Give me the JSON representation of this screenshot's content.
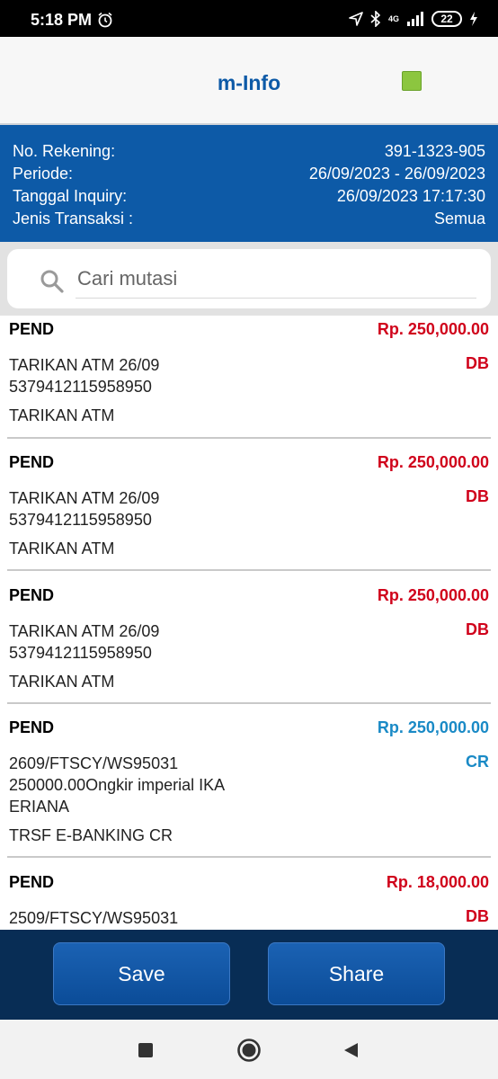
{
  "status_bar": {
    "time": "5:18 PM",
    "battery": "22",
    "network": "4G",
    "icons": [
      "alarm-icon",
      "location-icon",
      "bluetooth-icon",
      "signal-icon",
      "battery-icon",
      "charging-icon"
    ]
  },
  "header": {
    "title": "m-Info",
    "indicator_color": "#8cc63f"
  },
  "account": {
    "rows": [
      {
        "label": "No. Rekening:",
        "value": "391-1323-905"
      },
      {
        "label": "Periode:",
        "value": "26/09/2023 - 26/09/2023"
      },
      {
        "label": "Tanggal Inquiry:",
        "value": "26/09/2023 17:17:30"
      },
      {
        "label": "Jenis Transaksi :",
        "value": "Semua"
      }
    ]
  },
  "search": {
    "placeholder": "Cari mutasi"
  },
  "transactions": [
    {
      "status": "PEND",
      "amount": "Rp. 250,000.00",
      "type": "DB",
      "description": "TARIKAN ATM 26/09\n5379412115958950",
      "category": "TARIKAN ATM"
    },
    {
      "status": "PEND",
      "amount": "Rp. 250,000.00",
      "type": "DB",
      "description": "TARIKAN ATM 26/09\n5379412115958950",
      "category": "TARIKAN ATM"
    },
    {
      "status": "PEND",
      "amount": "Rp. 250,000.00",
      "type": "DB",
      "description": "TARIKAN ATM 26/09\n5379412115958950",
      "category": "TARIKAN ATM"
    },
    {
      "status": "PEND",
      "amount": "Rp. 250,000.00",
      "type": "CR",
      "description": "2609/FTSCY/WS95031\n250000.00Ongkir imperial   IKA\nERIANA",
      "category": "TRSF E-BANKING CR"
    },
    {
      "status": "PEND",
      "amount": "Rp. 18,000.00",
      "type": "DB",
      "description": "2509/FTSCY/WS95031",
      "category": ""
    }
  ],
  "colors": {
    "debit": "#d0021b",
    "credit": "#1a8ac6",
    "panel": "#0d5aa7"
  },
  "actions": {
    "save_label": "Save",
    "share_label": "Share"
  },
  "nav": {
    "recents": "square-icon",
    "home": "circle-icon",
    "back": "triangle-back-icon"
  }
}
